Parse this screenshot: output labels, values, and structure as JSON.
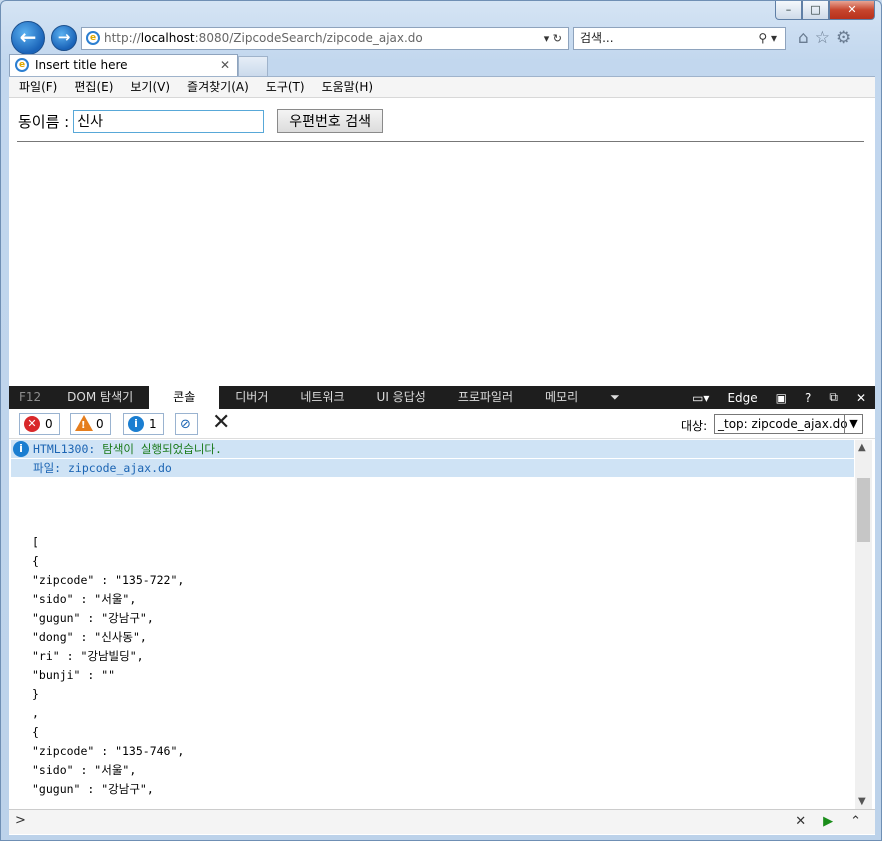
{
  "browser": {
    "address": {
      "prefix": "http://",
      "host": "localhost",
      "rest": ":8080/ZipcodeSearch/zipcode_ajax.do"
    },
    "search_placeholder": "검색...",
    "tab_title": "Insert title here",
    "window_buttons": {
      "minimize": "–",
      "maximize": "□",
      "close": "✕"
    }
  },
  "menubar": {
    "items": [
      "파일(F)",
      "편집(E)",
      "보기(V)",
      "즐겨찾기(A)",
      "도구(T)",
      "도움말(H)"
    ]
  },
  "page": {
    "label": "동이름 :",
    "input_value": "신사",
    "button_label": "우편번호 검색"
  },
  "devtools": {
    "tabs": [
      "F12",
      "DOM 탐색기",
      "콘솔",
      "디버거",
      "네트워크",
      "UI 응답성",
      "프로파일러",
      "메모리"
    ],
    "active_tab": "콘솔",
    "mode_label": "Edge",
    "counts": {
      "errors": "0",
      "warnings": "0",
      "info": "1"
    },
    "target_label": "대상:",
    "target_value": "_top: zipcode_ajax.do",
    "message": {
      "code": "HTML1300:",
      "text": "탐색이 실행되었습니다."
    },
    "file_line": "파일: zipcode_ajax.do",
    "json_lines": [
      "[",
      "{",
      "\"zipcode\" : \"135-722\",",
      "\"sido\" : \"서울\",",
      "\"gugun\" : \"강남구\",",
      "\"dong\" : \"신사동\",",
      "\"ri\" : \"강남빌딩\",",
      "\"bunji\" : \"\"",
      "}",
      ",",
      "{",
      "\"zipcode\" : \"135-746\",",
      "\"sido\" : \"서울\",",
      "\"gugun\" : \"강남구\","
    ]
  }
}
